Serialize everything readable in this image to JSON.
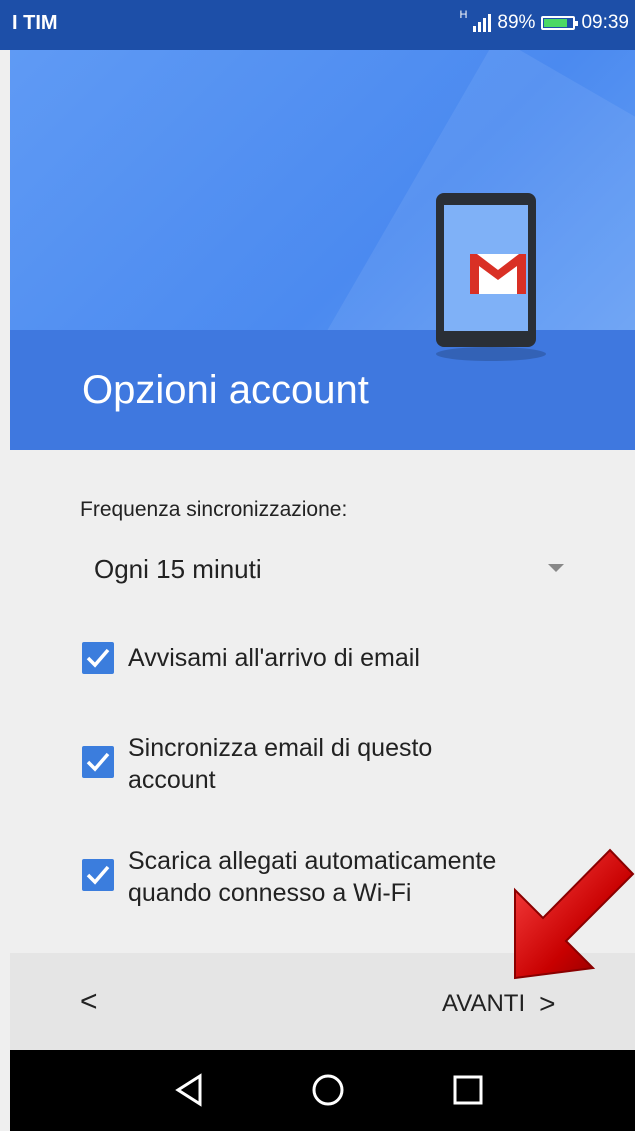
{
  "status_bar": {
    "carrier": "I TIM",
    "network_type": "H",
    "battery_percent": "89%",
    "time": "09:39",
    "battery_level": 0.89
  },
  "header": {
    "title": "Opzioni account",
    "illustration_icon": "gmail-icon"
  },
  "sync": {
    "label": "Frequenza sincronizzazione:",
    "selected": "Ogni 15 minuti"
  },
  "options": [
    {
      "label": "Avvisami all'arrivo di email",
      "checked": true
    },
    {
      "label": "Sincronizza email di questo account",
      "checked": true
    },
    {
      "label": "Scarica allegati automaticamente quando connesso a Wi-Fi",
      "checked": true
    }
  ],
  "footer": {
    "back_label": "<",
    "next_label": "AVANTI",
    "next_chevron": ">"
  },
  "nav_bar": {
    "buttons": [
      "back-triangle-icon",
      "home-circle-icon",
      "recents-square-icon"
    ]
  },
  "colors": {
    "status_bar": "#1d4fa8",
    "hero": "#4b8af0",
    "band": "#3f78df",
    "checkbox": "#3b7ddd",
    "arrow": "#d40000"
  }
}
